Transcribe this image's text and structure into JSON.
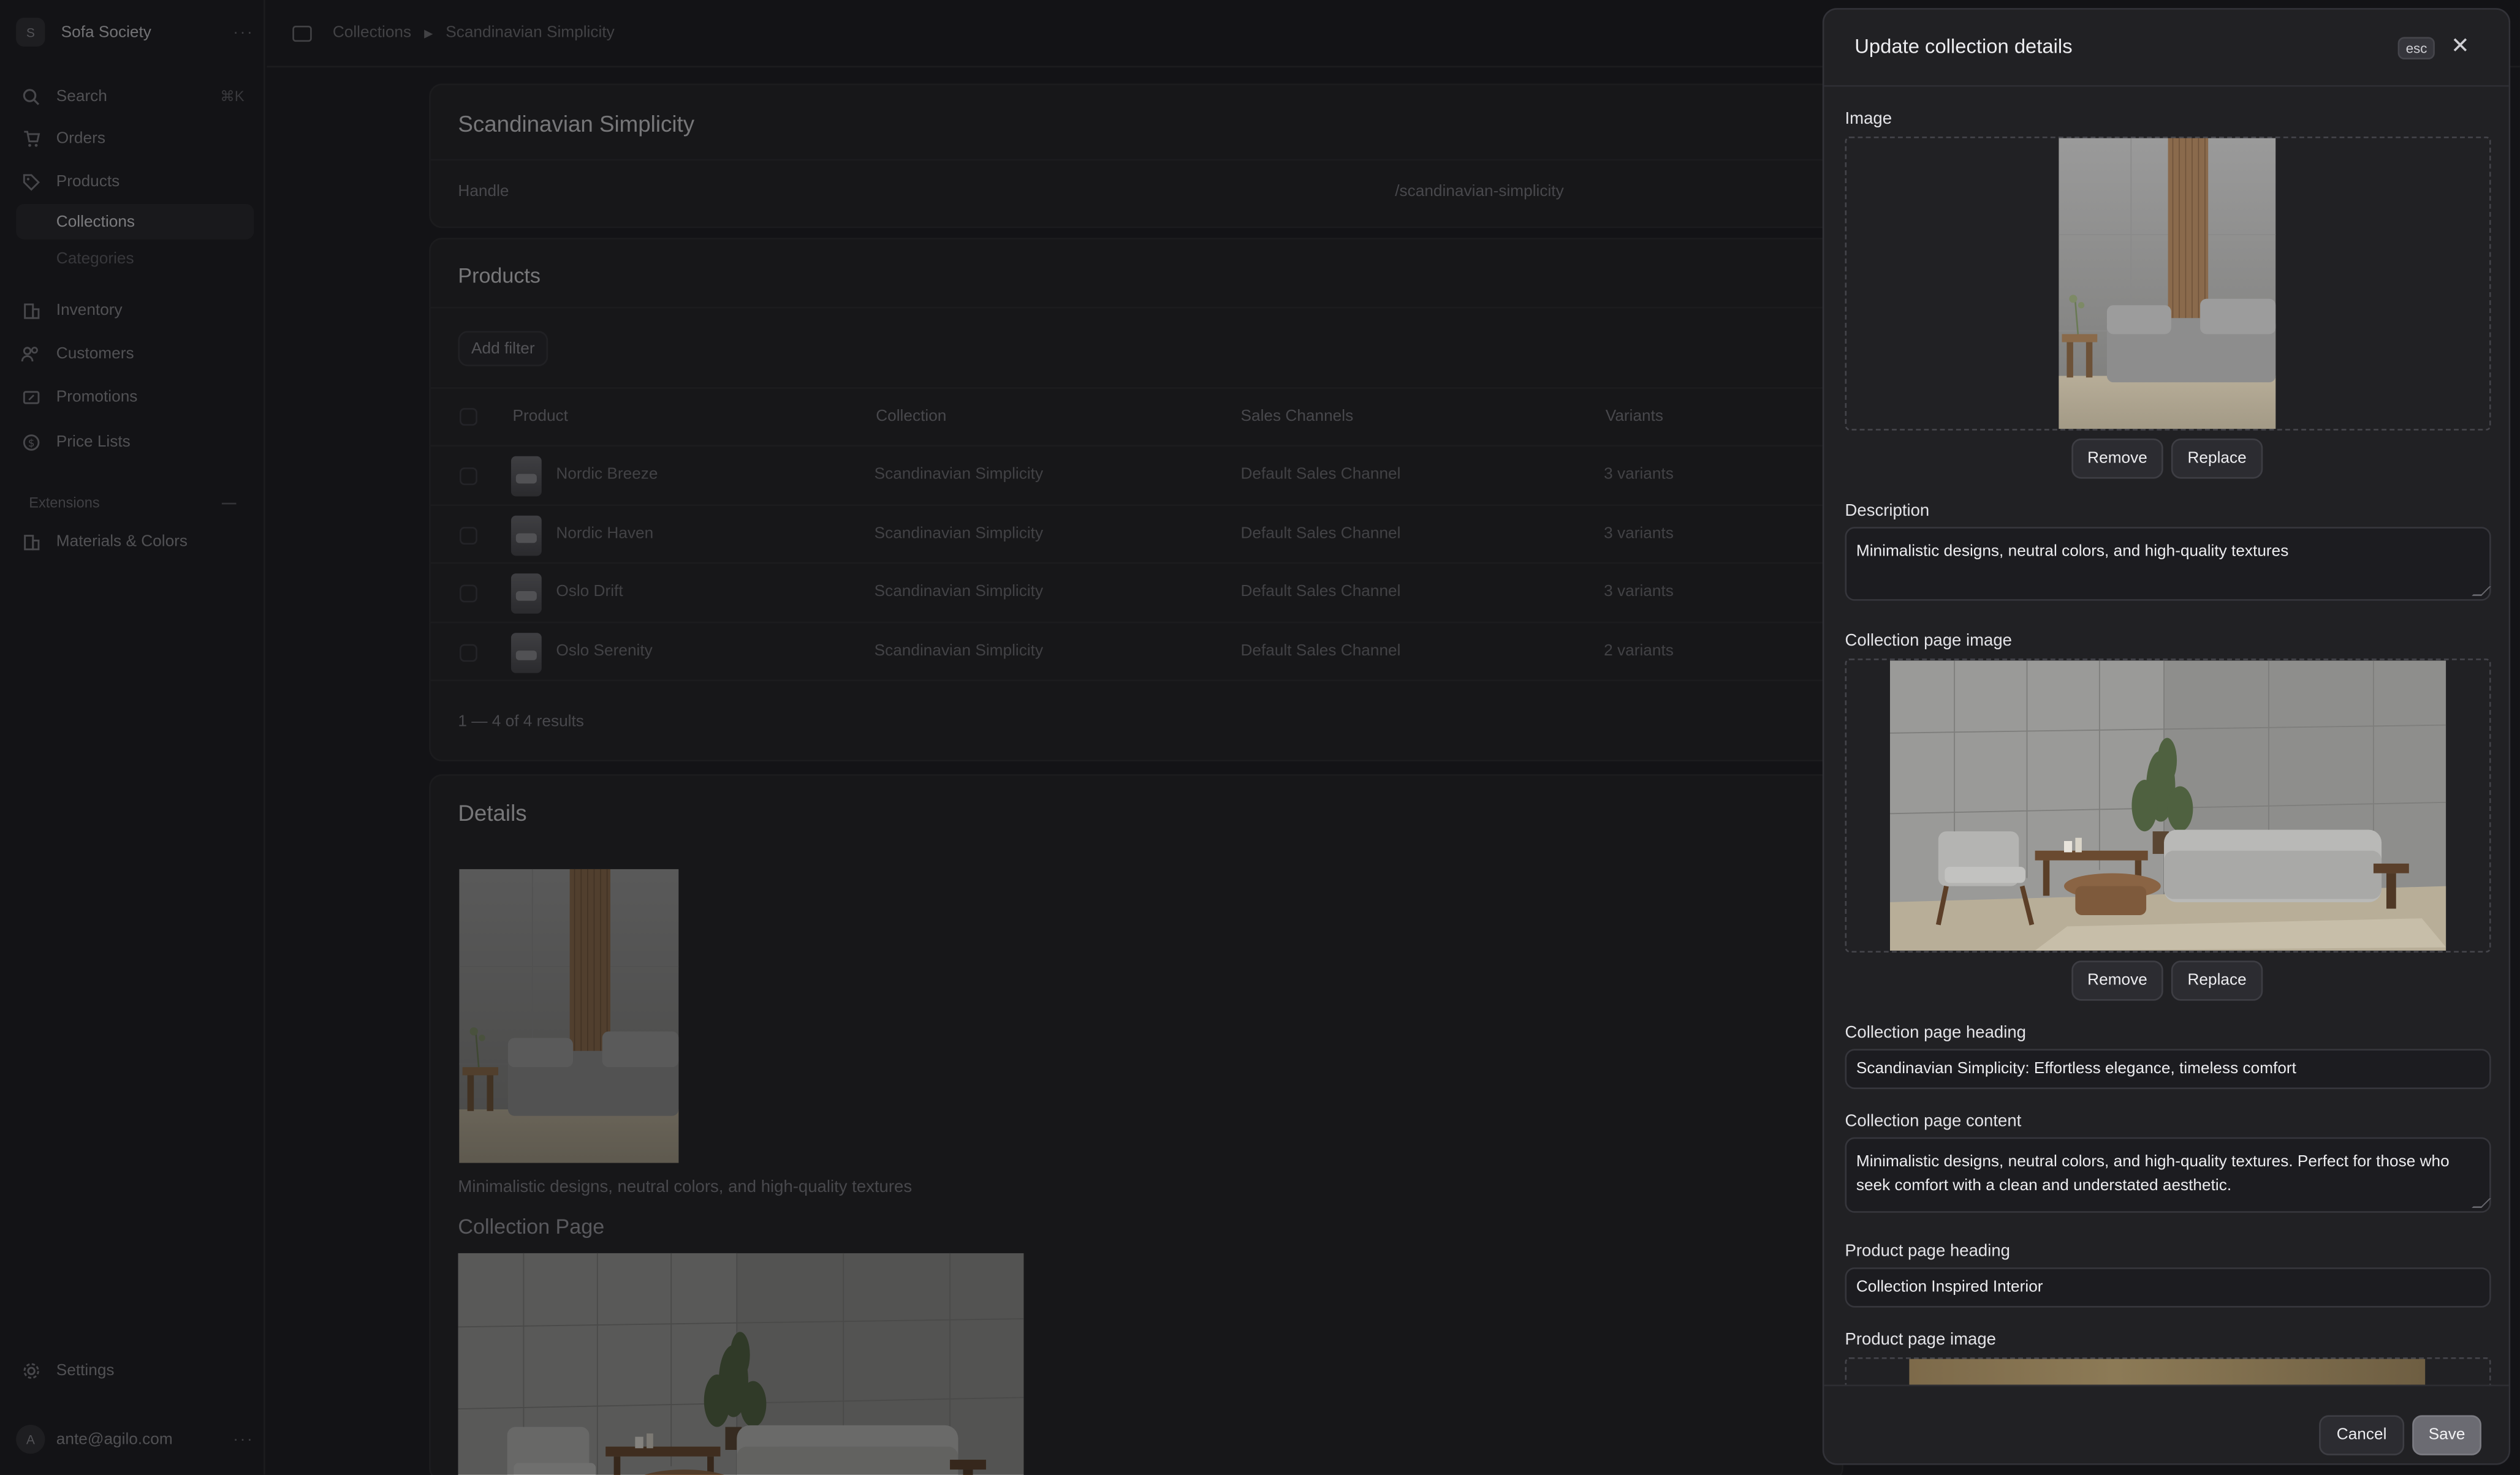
{
  "sidebar": {
    "store_initial": "S",
    "store_name": "Sofa Society",
    "search_label": "Search",
    "search_shortcut": "⌘K",
    "items": [
      {
        "label": "Orders"
      },
      {
        "label": "Products"
      },
      {
        "label": "Collections"
      },
      {
        "label": "Categories"
      },
      {
        "label": "Inventory"
      },
      {
        "label": "Customers"
      },
      {
        "label": "Promotions"
      },
      {
        "label": "Price Lists"
      }
    ],
    "extensions_label": "Extensions",
    "extension_items": [
      {
        "label": "Materials & Colors"
      }
    ],
    "settings_label": "Settings",
    "user_initial": "A",
    "user_email": "ante@agilo.com"
  },
  "breadcrumb": {
    "root": "Collections",
    "current": "Scandinavian Simplicity"
  },
  "collection": {
    "title": "Scandinavian Simplicity",
    "handle_label": "Handle",
    "handle_value": "/scandinavian-simplicity"
  },
  "products_section": {
    "title": "Products",
    "add_filter": "Add filter",
    "columns": [
      "Product",
      "Collection",
      "Sales Channels",
      "Variants"
    ],
    "rows": [
      {
        "product": "Nordic Breeze",
        "collection": "Scandinavian Simplicity",
        "channel": "Default Sales Channel",
        "variants": "3 variants"
      },
      {
        "product": "Nordic Haven",
        "collection": "Scandinavian Simplicity",
        "channel": "Default Sales Channel",
        "variants": "3 variants"
      },
      {
        "product": "Oslo Drift",
        "collection": "Scandinavian Simplicity",
        "channel": "Default Sales Channel",
        "variants": "3 variants"
      },
      {
        "product": "Oslo Serenity",
        "collection": "Scandinavian Simplicity",
        "channel": "Default Sales Channel",
        "variants": "2 variants"
      }
    ],
    "pagination": "1 — 4 of 4 results"
  },
  "details_section": {
    "title": "Details",
    "description": "Minimalistic designs, neutral colors, and high-quality textures",
    "collection_page_label": "Collection Page"
  },
  "drawer": {
    "title": "Update collection details",
    "esc_label": "esc",
    "image_label": "Image",
    "remove_label": "Remove",
    "replace_label": "Replace",
    "description_label": "Description",
    "description_value": "Minimalistic designs, neutral colors, and high-quality textures",
    "collection_page_image_label": "Collection page image",
    "collection_page_heading_label": "Collection page heading",
    "collection_page_heading_value": "Scandinavian Simplicity: Effortless elegance, timeless comfort",
    "collection_page_content_label": "Collection page content",
    "collection_page_content_value": "Minimalistic designs, neutral colors, and high-quality textures. Perfect for those who seek comfort with a clean and understated aesthetic.",
    "product_page_heading_label": "Product page heading",
    "product_page_heading_value": "Collection Inspired Interior",
    "product_page_image_label": "Product page image",
    "cancel_label": "Cancel",
    "save_label": "Save"
  },
  "colors": {
    "background": "#1b1b1f",
    "drawer_background": "#212124",
    "text_primary": "#ededf0",
    "text_muted": "#7b7b82"
  }
}
